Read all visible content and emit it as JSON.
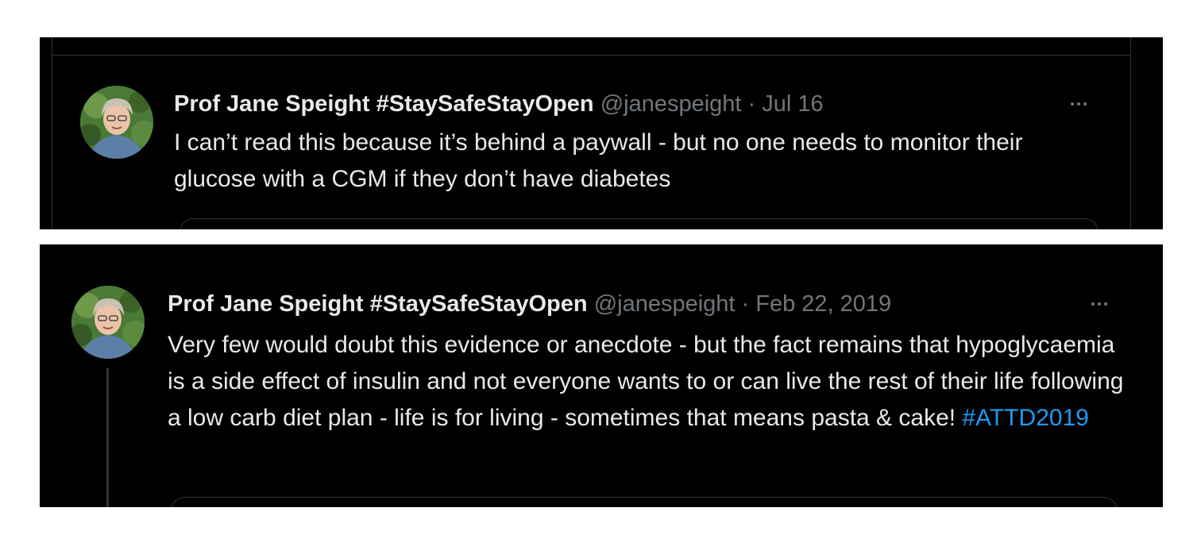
{
  "tweets": [
    {
      "author": {
        "display_name": "Prof Jane Speight #StaySafeStayOpen",
        "handle": "@janespeight"
      },
      "separator": " · ",
      "date": "Jul 16",
      "more_icon": "more-horizontal-icon",
      "text": "I can’t read this because it’s behind a paywall - but no one needs to monitor their glucose with a CGM if they don’t have diabetes"
    },
    {
      "author": {
        "display_name": "Prof Jane Speight #StaySafeStayOpen",
        "handle": "@janespeight"
      },
      "separator": " · ",
      "date": "Feb 22, 2019",
      "more_icon": "more-horizontal-icon",
      "text": "Very few would doubt this evidence or anecdote - but the fact remains that hypoglycaemia is a side effect of insulin and not everyone wants to or can live the rest of their life following a low carb diet plan - life is for living - sometimes that means pasta & cake! ",
      "hashtag": "#ATTD2019"
    }
  ],
  "colors": {
    "background": "#000000",
    "text_primary": "#e7e9ea",
    "text_secondary": "#71767b",
    "link": "#1d9bf0",
    "border": "#2f3336"
  }
}
